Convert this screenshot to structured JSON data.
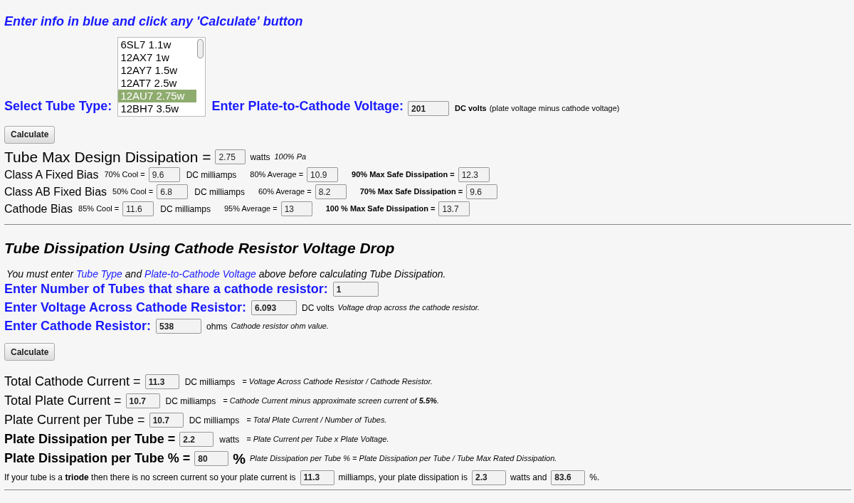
{
  "heading": "Enter info in blue and click any 'Calculate' button",
  "tube_select": {
    "label": "Select Tube Type:",
    "options": [
      {
        "label": "6SL7 1.1w",
        "selected": false
      },
      {
        "label": "12AX7 1w",
        "selected": false
      },
      {
        "label": "12AY7 1.5w",
        "selected": false
      },
      {
        "label": "12AT7 2.5w",
        "selected": false
      },
      {
        "label": "12AU7 2.75w",
        "selected": true
      },
      {
        "label": "12BH7 3.5w",
        "selected": false
      }
    ]
  },
  "voltage": {
    "label": "Enter Plate-to-Cathode Voltage:",
    "value": "201",
    "unit": "DC volts",
    "note": "(plate voltage minus cathode voltage)"
  },
  "calculate_top": "Calculate",
  "max_dissipation": {
    "label": "Tube Max Design Dissipation =",
    "value": "2.75",
    "unit": "watts",
    "note": "100% Pa"
  },
  "bias_rows": [
    {
      "label": "Class A Fixed Bias",
      "cool": {
        "label": "70% Cool =",
        "value": "9.6"
      },
      "unit": "DC milliamps",
      "average": {
        "label": "80% Average =",
        "value": "10.9"
      },
      "max": {
        "label": "90% Max Safe Dissipation =",
        "value": "12.3"
      }
    },
    {
      "label": "Class AB Fixed Bias",
      "cool": {
        "label": "50% Cool =",
        "value": "6.8"
      },
      "unit": "DC milliamps",
      "average": {
        "label": "60% Average =",
        "value": "8.2"
      },
      "max": {
        "label": "70% Max Safe Dissipation =",
        "value": "9.6"
      }
    },
    {
      "label": "Cathode Bias",
      "cool": {
        "label": "85% Cool =",
        "value": "11.6"
      },
      "unit": "DC milliamps",
      "average": {
        "label": "95% Average =",
        "value": "13"
      },
      "max": {
        "label": "100 % Max Safe Dissipation =",
        "value": "13.7"
      }
    }
  ],
  "section_title": "Tube Dissipation Using Cathode Resistor Voltage Drop",
  "instruction": [
    {
      "kind": "text",
      "text": "You must enter "
    },
    {
      "kind": "link",
      "text": "Tube Type"
    },
    {
      "kind": "text",
      "text": " and "
    },
    {
      "kind": "link",
      "text": "Plate-to-Cathode Voltage"
    },
    {
      "kind": "text",
      "text": " above before calculating Tube Dissipation."
    }
  ],
  "inputs": [
    {
      "label": "Enter Number of Tubes that share a cathode resistor:",
      "value": "1"
    },
    {
      "label": "Enter Voltage Across Cathode Resistor:",
      "value": "6.093",
      "unit": "DC volts",
      "note": "Voltage drop across the cathode resistor."
    },
    {
      "label": "Enter Cathode Resistor:",
      "value": "538",
      "unit": "ohms",
      "note": "Cathode resistor ohm value."
    }
  ],
  "calculate_bottom": "Calculate",
  "results": [
    {
      "kind": "normal",
      "label": "Total Cathode Current =",
      "value": "11.3",
      "unit": "DC milliamps",
      "note": "= Voltage Across Cathode Resistor / Cathode Resistor."
    },
    {
      "kind": "normal",
      "label": "Total Plate Current =",
      "value": "10.7",
      "unit": "DC milliamps",
      "note": "= Cathode Current minus approximate screen current of **5.5%**."
    },
    {
      "kind": "normal",
      "label": "Plate Current per Tube =",
      "value": "10.7",
      "unit": "DC milliamps",
      "note": "= Total Plate Current / Number of Tubes."
    },
    {
      "kind": "bold",
      "label": "Plate Dissipation per Tube =",
      "value": "2.2",
      "unit": "watts",
      "note": "= Plate Current per Tube x Plate Voltage."
    },
    {
      "kind": "bold",
      "label": "Plate Dissipation per Tube % =",
      "value": "80",
      "unit": "%",
      "note": "Plate Dissipation per Tube % = Plate Dissipation per Tube / Tube Max Rated Dissipation."
    }
  ],
  "triode": [
    {
      "kind": "text",
      "text": "If your tube is a **triode** then there is no screen current so your plate current is"
    },
    {
      "kind": "field",
      "text": "11.3"
    },
    {
      "kind": "text",
      "text": "milliamps, your plate dissipation is"
    },
    {
      "kind": "field",
      "text": "2.3"
    },
    {
      "kind": "text",
      "text": "watts and"
    },
    {
      "kind": "field",
      "text": "83.6"
    },
    {
      "kind": "text",
      "text": "%."
    }
  ]
}
